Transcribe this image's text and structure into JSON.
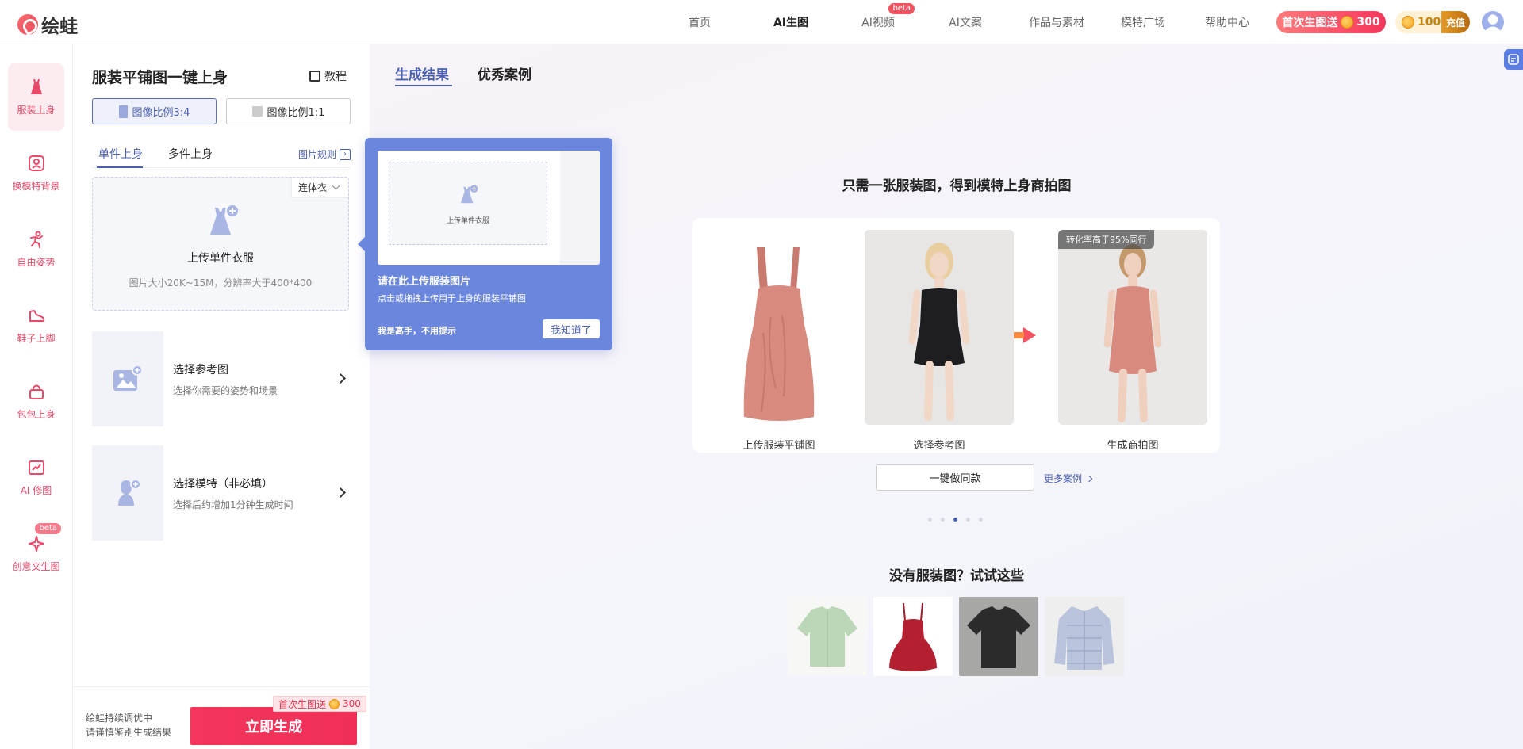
{
  "header": {
    "logo_text": "绘蛙",
    "nav": [
      {
        "label": "首页"
      },
      {
        "label": "AI生图",
        "active": true
      },
      {
        "label": "AI视频",
        "badge": "beta"
      },
      {
        "label": "AI文案"
      },
      {
        "label": "作品与素材"
      },
      {
        "label": "模特广场"
      },
      {
        "label": "帮助中心"
      }
    ],
    "promo_label": "首次生图送",
    "promo_value": "300",
    "coins": "100",
    "recharge_label": "充值"
  },
  "rail": [
    {
      "label": "服装上身",
      "icon": "dress-icon",
      "active": true
    },
    {
      "label": "换模特背景",
      "icon": "portrait-icon"
    },
    {
      "label": "自由姿势",
      "icon": "pose-icon"
    },
    {
      "label": "鞋子上脚",
      "icon": "shoe-icon"
    },
    {
      "label": "包包上身",
      "icon": "bag-icon"
    },
    {
      "label": "AI 修图",
      "icon": "retouch-icon"
    },
    {
      "label": "创意文生图",
      "icon": "sparkle-icon",
      "badge": "beta"
    }
  ],
  "panel": {
    "title": "服装平铺图一键上身",
    "tutorial_label": "教程",
    "ratio_a": "图像比例3:4",
    "ratio_b": "图像比例1:1",
    "tab_single": "单件上身",
    "tab_multi": "多件上身",
    "pic_rule": "图片规则",
    "garment_type": "连体衣",
    "upload_title": "上传单件衣服",
    "upload_hint": "图片大小20K~15M，分辨率大于400*400",
    "ref_title": "选择参考图",
    "ref_sub": "选择你需要的姿势和场景",
    "model_title": "选择模特（非必填）",
    "model_sub": "选择后约增加1分钟生成时间",
    "note_line1": "绘蛙持续调优中",
    "note_line2": "请谨慎鉴别生成结果",
    "generate_label": "立即生成",
    "gen_badge_label": "首次生图送",
    "gen_badge_value": "300"
  },
  "main": {
    "tab_result": "生成结果",
    "tab_cases": "优秀案例",
    "showcase_title": "只需一张服装图，得到模特上身商拍图",
    "step1": "上传服装平铺图",
    "step2": "选择参考图",
    "step3": "生成商拍图",
    "rate_badge": "转化率高于95%同行",
    "same_btn": "一键做同款",
    "more_cases": "更多案例",
    "carousel_active_index": 2,
    "try_title": "没有服装图？试试这些"
  },
  "guide": {
    "preview_text": "上传单件衣服",
    "title": "请在此上传服装图片",
    "sub": "点击或拖拽上传用于上身的服装平铺图",
    "skip": "我是高手，不用提示",
    "ok": "我知道了"
  },
  "colors": {
    "accent": "#4a5fae",
    "brand_red": "#f5365c",
    "guide_blue": "#6b87dd"
  }
}
